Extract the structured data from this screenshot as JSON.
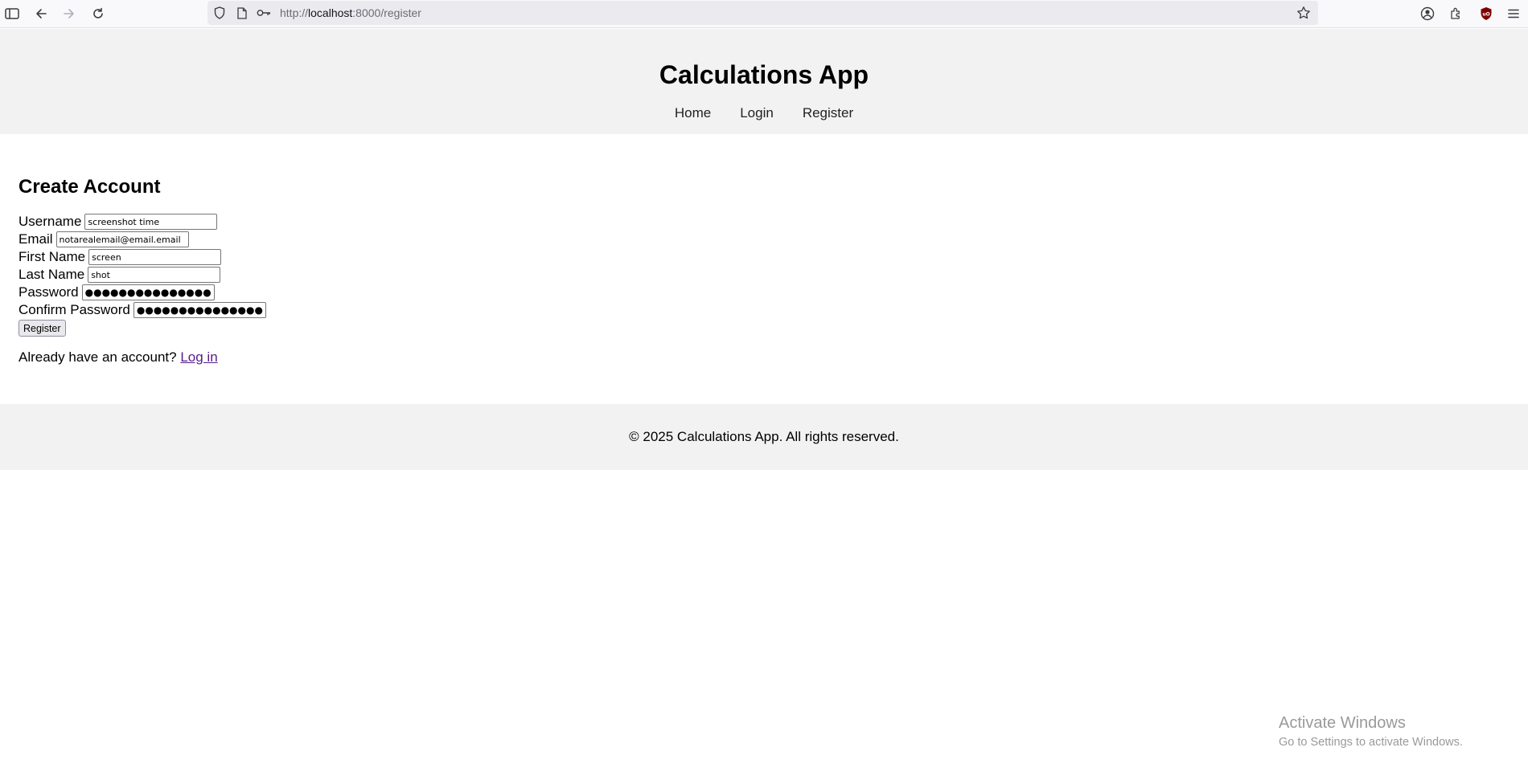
{
  "browser": {
    "url_scheme": "http://",
    "url_host": "localhost",
    "url_path": ":8000/register",
    "icons": [
      "sidebar-icon",
      "back-icon",
      "forward-icon",
      "reload-icon",
      "shield-icon",
      "page-icon",
      "key-icon",
      "bookmark-star-icon",
      "account-icon",
      "extensions-icon",
      "ublock-icon",
      "menu-icon"
    ]
  },
  "header": {
    "title": "Calculations App",
    "nav": [
      {
        "label": "Home"
      },
      {
        "label": "Login"
      },
      {
        "label": "Register"
      }
    ]
  },
  "main": {
    "heading": "Create Account",
    "fields": [
      {
        "label": "Username",
        "value": "screenshot time"
      },
      {
        "label": "Email",
        "value": "notarealemail@email.email"
      },
      {
        "label": "First Name",
        "value": "screen"
      },
      {
        "label": "Last Name",
        "value": "shot"
      },
      {
        "label": "Password",
        "value": "●●●●●●●●●●●●●●●●"
      },
      {
        "label": "Confirm Password",
        "value": "●●●●●●●●●●●●●●●●"
      }
    ],
    "submit_label": "Register",
    "login_prompt": "Already have an account?",
    "login_link": "Log in"
  },
  "footer": {
    "text": "© 2025 Calculations App. All rights reserved."
  },
  "watermark": {
    "title": "Activate Windows",
    "subtitle": "Go to Settings to activate Windows."
  },
  "colors": {
    "header_bg": "#f2f2f2",
    "visited_link": "#551a8b",
    "urlbar_bg": "#ebebef"
  }
}
